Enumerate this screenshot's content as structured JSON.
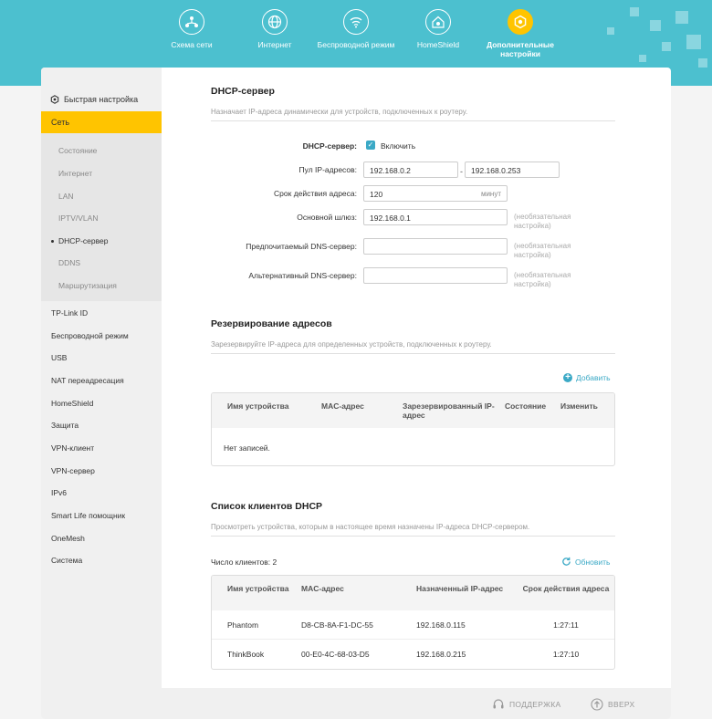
{
  "topnav": {
    "items": [
      {
        "label": "Схема сети",
        "icon": "network-map-icon"
      },
      {
        "label": "Интернет",
        "icon": "globe-icon"
      },
      {
        "label": "Беспроводной режим",
        "icon": "wifi-icon"
      },
      {
        "label": "HomeShield",
        "icon": "homeshield-icon"
      },
      {
        "label": "Дополнительные настройки",
        "icon": "gear-icon",
        "active": true
      }
    ]
  },
  "sidebar": {
    "quick_setup": "Быстрая настройка",
    "active_section": "Сеть",
    "subitems": [
      "Состояние",
      "Интернет",
      "LAN",
      "IPTV/VLAN",
      "DHCP-сервер",
      "DDNS",
      "Маршрутизация"
    ],
    "current_subitem": "DHCP-сервер",
    "items": [
      "TP-Link ID",
      "Беспроводной режим",
      "USB",
      "NAT переадресация",
      "HomeShield",
      "Защита",
      "VPN-клиент",
      "VPN-сервер",
      "IPv6",
      "Smart Life помощник",
      "OneMesh",
      "Система"
    ]
  },
  "dhcp": {
    "title": "DHCP-сервер",
    "desc": "Назначает IP-адреса динамически для устройств, подключенных к роутеру.",
    "enable_label": "DHCP-сервер:",
    "enable_text": "Включить",
    "enabled": true,
    "pool_label": "Пул IP-адресов:",
    "pool_start": "192.168.0.2",
    "pool_end": "192.168.0.253",
    "lease_label": "Срок действия адреса:",
    "lease_value": "120",
    "lease_unit": "минут",
    "gateway_label": "Основной шлюз:",
    "gateway_value": "192.168.0.1",
    "optional": "(необязательная настройка)",
    "dns1_label": "Предпочитаемый DNS-сервер:",
    "dns2_label": "Альтернативный DNS-сервер:"
  },
  "reservation": {
    "title": "Резервирование адресов",
    "desc": "Зарезервируйте IP-адреса для определенных устройств, подключенных к роутеру.",
    "add_label": "Добавить",
    "columns": [
      "Имя устройства",
      "MAC-адрес",
      "Зарезервированный IP-адрес",
      "Состояние",
      "Изменить"
    ],
    "empty_text": "Нет записей."
  },
  "clients": {
    "title": "Список клиентов DHCP",
    "desc": "Просмотреть устройства, которым в настоящее время назначены IP-адреса DHCP-сервером.",
    "count_label": "Число клиентов: 2",
    "refresh_label": "Обновить",
    "columns": [
      "Имя устройства",
      "MAC-адрес",
      "Назначенный IP-адрес",
      "Срок действия адреса"
    ],
    "rows": [
      {
        "name": "Phantom",
        "mac": "D8-CB-8A-F1-DC-55",
        "ip": "192.168.0.115",
        "lease": "1:27:11"
      },
      {
        "name": "ThinkBook",
        "mac": "00-E0-4C-68-03-D5",
        "ip": "192.168.0.215",
        "lease": "1:27:10"
      }
    ]
  },
  "footer": {
    "support": "ПОДДЕРЖКА",
    "top": "ВВЕРХ"
  }
}
